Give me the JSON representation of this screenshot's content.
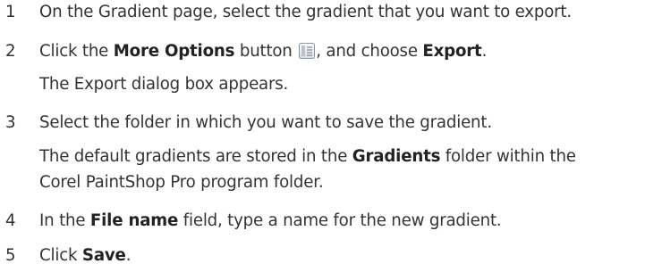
{
  "steps": [
    {
      "number": "1",
      "text": "On the Gradient page, select the gradient that you want to export."
    },
    {
      "number": "2",
      "pre": "Click the ",
      "bold1": "More Options",
      "mid": " button ",
      "icon": "more-options-icon",
      "post": ", and choose ",
      "bold2": "Export",
      "end": ".",
      "result": "The Export dialog box appears."
    },
    {
      "number": "3",
      "text": "Select the folder in which you want to save the gradient.",
      "note_pre": "The default gradients are stored in the ",
      "note_bold": "Gradients",
      "note_post": " folder within the",
      "note_line2": "Corel PaintShop Pro program folder."
    },
    {
      "number": "4",
      "pre": "In the ",
      "bold": "File name",
      "post": " field, type a name for the new gradient."
    },
    {
      "number": "5",
      "pre": "Click ",
      "bold": "Save",
      "post": "."
    }
  ]
}
